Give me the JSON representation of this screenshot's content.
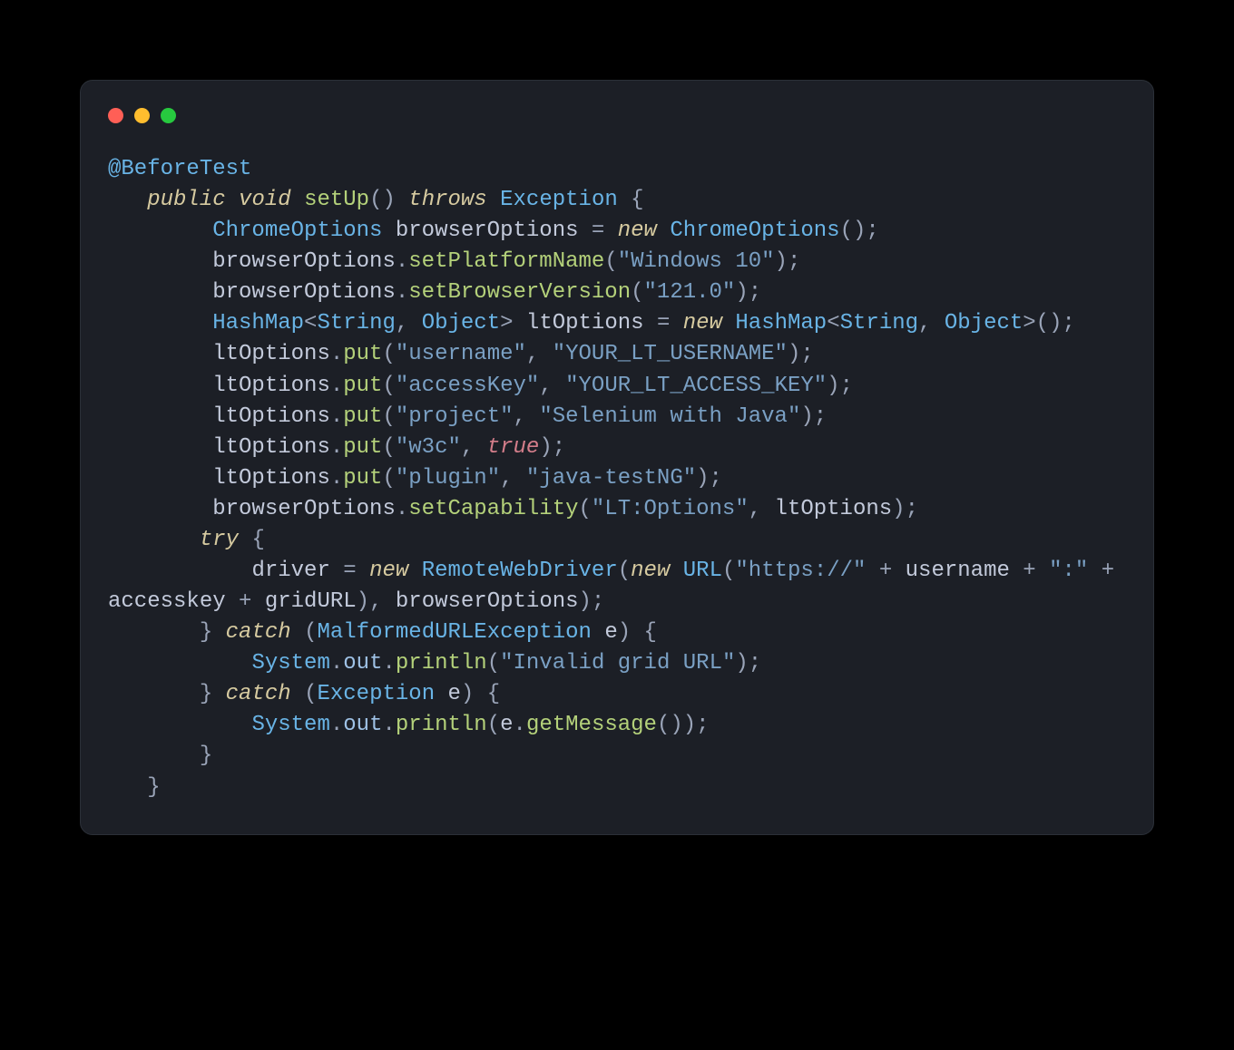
{
  "theme": {
    "background": "#000000",
    "panel_bg": "#1c1f26",
    "panel_border": "#2b3038",
    "traffic_red": "#ff5f56",
    "traffic_yellow": "#ffbd2e",
    "traffic_green": "#27c93f",
    "default_text": "#c3cadb",
    "annotation": "#69b4e6",
    "keyword": "#d6caa0",
    "type": "#69b4e6",
    "method": "#b4d17a",
    "string": "#7aa0c4",
    "literal": "#d37d8a",
    "punctuation": "#9aa4b8",
    "field": "#9fc2e6"
  },
  "code": {
    "language": "java",
    "plain_text": "@BeforeTest\n   public void setUp() throws Exception {\n        ChromeOptions browserOptions = new ChromeOptions();\n        browserOptions.setPlatformName(\"Windows 10\");\n        browserOptions.setBrowserVersion(\"121.0\");\n        HashMap<String, Object> ltOptions = new HashMap<String, Object>();\n        ltOptions.put(\"username\", \"YOUR_LT_USERNAME\");\n        ltOptions.put(\"accessKey\", \"YOUR_LT_ACCESS_KEY\");\n        ltOptions.put(\"project\", \"Selenium with Java\");\n        ltOptions.put(\"w3c\", true);\n        ltOptions.put(\"plugin\", \"java-testNG\");\n        browserOptions.setCapability(\"LT:Options\", ltOptions);\n       try {\n           driver = new RemoteWebDriver(new URL(\"https://\" + username + \":\" + accesskey + gridURL), browserOptions);\n       } catch (MalformedURLException e) {\n           System.out.println(\"Invalid grid URL\");\n       } catch (Exception e) {\n           System.out.println(e.getMessage());\n       }\n   }",
    "lines": [
      [
        {
          "t": "annot",
          "v": "@BeforeTest"
        }
      ],
      [
        {
          "t": "sp",
          "v": "   "
        },
        {
          "t": "kw",
          "v": "public"
        },
        {
          "t": "sp",
          "v": " "
        },
        {
          "t": "kw",
          "v": "void"
        },
        {
          "t": "sp",
          "v": " "
        },
        {
          "t": "method",
          "v": "setUp"
        },
        {
          "t": "punct",
          "v": "()"
        },
        {
          "t": "sp",
          "v": " "
        },
        {
          "t": "kw",
          "v": "throws"
        },
        {
          "t": "sp",
          "v": " "
        },
        {
          "t": "type",
          "v": "Exception"
        },
        {
          "t": "sp",
          "v": " "
        },
        {
          "t": "punct",
          "v": "{"
        }
      ],
      [
        {
          "t": "sp",
          "v": "        "
        },
        {
          "t": "type",
          "v": "ChromeOptions"
        },
        {
          "t": "sp",
          "v": " "
        },
        {
          "t": "ident",
          "v": "browserOptions"
        },
        {
          "t": "sp",
          "v": " "
        },
        {
          "t": "punct",
          "v": "="
        },
        {
          "t": "sp",
          "v": " "
        },
        {
          "t": "kw",
          "v": "new"
        },
        {
          "t": "sp",
          "v": " "
        },
        {
          "t": "type",
          "v": "ChromeOptions"
        },
        {
          "t": "punct",
          "v": "();"
        }
      ],
      [
        {
          "t": "sp",
          "v": "        "
        },
        {
          "t": "ident",
          "v": "browserOptions"
        },
        {
          "t": "punct",
          "v": "."
        },
        {
          "t": "method",
          "v": "setPlatformName"
        },
        {
          "t": "punct",
          "v": "("
        },
        {
          "t": "str",
          "v": "\"Windows 10\""
        },
        {
          "t": "punct",
          "v": ");"
        }
      ],
      [
        {
          "t": "sp",
          "v": "        "
        },
        {
          "t": "ident",
          "v": "browserOptions"
        },
        {
          "t": "punct",
          "v": "."
        },
        {
          "t": "method",
          "v": "setBrowserVersion"
        },
        {
          "t": "punct",
          "v": "("
        },
        {
          "t": "str",
          "v": "\"121.0\""
        },
        {
          "t": "punct",
          "v": ");"
        }
      ],
      [
        {
          "t": "sp",
          "v": "        "
        },
        {
          "t": "type",
          "v": "HashMap"
        },
        {
          "t": "punct",
          "v": "<"
        },
        {
          "t": "type",
          "v": "String"
        },
        {
          "t": "punct",
          "v": ", "
        },
        {
          "t": "type",
          "v": "Object"
        },
        {
          "t": "punct",
          "v": ">"
        },
        {
          "t": "sp",
          "v": " "
        },
        {
          "t": "ident",
          "v": "ltOptions"
        },
        {
          "t": "sp",
          "v": " "
        },
        {
          "t": "punct",
          "v": "="
        },
        {
          "t": "sp",
          "v": " "
        },
        {
          "t": "kw",
          "v": "new"
        },
        {
          "t": "sp",
          "v": " "
        },
        {
          "t": "type",
          "v": "HashMap"
        },
        {
          "t": "punct",
          "v": "<"
        },
        {
          "t": "type",
          "v": "String"
        },
        {
          "t": "punct",
          "v": ", "
        },
        {
          "t": "type",
          "v": "Object"
        },
        {
          "t": "punct",
          "v": ">();"
        }
      ],
      [
        {
          "t": "sp",
          "v": "        "
        },
        {
          "t": "ident",
          "v": "ltOptions"
        },
        {
          "t": "punct",
          "v": "."
        },
        {
          "t": "method",
          "v": "put"
        },
        {
          "t": "punct",
          "v": "("
        },
        {
          "t": "str",
          "v": "\"username\""
        },
        {
          "t": "punct",
          "v": ", "
        },
        {
          "t": "str",
          "v": "\"YOUR_LT_USERNAME\""
        },
        {
          "t": "punct",
          "v": ");"
        }
      ],
      [
        {
          "t": "sp",
          "v": "        "
        },
        {
          "t": "ident",
          "v": "ltOptions"
        },
        {
          "t": "punct",
          "v": "."
        },
        {
          "t": "method",
          "v": "put"
        },
        {
          "t": "punct",
          "v": "("
        },
        {
          "t": "str",
          "v": "\"accessKey\""
        },
        {
          "t": "punct",
          "v": ", "
        },
        {
          "t": "str",
          "v": "\"YOUR_LT_ACCESS_KEY\""
        },
        {
          "t": "punct",
          "v": ");"
        }
      ],
      [
        {
          "t": "sp",
          "v": "        "
        },
        {
          "t": "ident",
          "v": "ltOptions"
        },
        {
          "t": "punct",
          "v": "."
        },
        {
          "t": "method",
          "v": "put"
        },
        {
          "t": "punct",
          "v": "("
        },
        {
          "t": "str",
          "v": "\"project\""
        },
        {
          "t": "punct",
          "v": ", "
        },
        {
          "t": "str",
          "v": "\"Selenium with Java\""
        },
        {
          "t": "punct",
          "v": ");"
        }
      ],
      [
        {
          "t": "sp",
          "v": "        "
        },
        {
          "t": "ident",
          "v": "ltOptions"
        },
        {
          "t": "punct",
          "v": "."
        },
        {
          "t": "method",
          "v": "put"
        },
        {
          "t": "punct",
          "v": "("
        },
        {
          "t": "str",
          "v": "\"w3c\""
        },
        {
          "t": "punct",
          "v": ", "
        },
        {
          "t": "lit",
          "v": "true"
        },
        {
          "t": "punct",
          "v": ");"
        }
      ],
      [
        {
          "t": "sp",
          "v": "        "
        },
        {
          "t": "ident",
          "v": "ltOptions"
        },
        {
          "t": "punct",
          "v": "."
        },
        {
          "t": "method",
          "v": "put"
        },
        {
          "t": "punct",
          "v": "("
        },
        {
          "t": "str",
          "v": "\"plugin\""
        },
        {
          "t": "punct",
          "v": ", "
        },
        {
          "t": "str",
          "v": "\"java-testNG\""
        },
        {
          "t": "punct",
          "v": ");"
        }
      ],
      [
        {
          "t": "sp",
          "v": "        "
        },
        {
          "t": "ident",
          "v": "browserOptions"
        },
        {
          "t": "punct",
          "v": "."
        },
        {
          "t": "method",
          "v": "setCapability"
        },
        {
          "t": "punct",
          "v": "("
        },
        {
          "t": "str",
          "v": "\"LT:Options\""
        },
        {
          "t": "punct",
          "v": ", "
        },
        {
          "t": "ident",
          "v": "ltOptions"
        },
        {
          "t": "punct",
          "v": ");"
        }
      ],
      [
        {
          "t": "sp",
          "v": "       "
        },
        {
          "t": "kw",
          "v": "try"
        },
        {
          "t": "sp",
          "v": " "
        },
        {
          "t": "punct",
          "v": "{"
        }
      ],
      [
        {
          "t": "sp",
          "v": "           "
        },
        {
          "t": "ident",
          "v": "driver"
        },
        {
          "t": "sp",
          "v": " "
        },
        {
          "t": "punct",
          "v": "="
        },
        {
          "t": "sp",
          "v": " "
        },
        {
          "t": "kw",
          "v": "new"
        },
        {
          "t": "sp",
          "v": " "
        },
        {
          "t": "type",
          "v": "RemoteWebDriver"
        },
        {
          "t": "punct",
          "v": "("
        },
        {
          "t": "kw",
          "v": "new"
        },
        {
          "t": "sp",
          "v": " "
        },
        {
          "t": "type",
          "v": "URL"
        },
        {
          "t": "punct",
          "v": "("
        },
        {
          "t": "str",
          "v": "\"https://\""
        },
        {
          "t": "sp",
          "v": " "
        },
        {
          "t": "punct",
          "v": "+"
        },
        {
          "t": "sp",
          "v": " "
        },
        {
          "t": "ident",
          "v": "username"
        },
        {
          "t": "sp",
          "v": " "
        },
        {
          "t": "punct",
          "v": "+"
        },
        {
          "t": "sp",
          "v": " "
        },
        {
          "t": "str",
          "v": "\":\""
        },
        {
          "t": "sp",
          "v": " "
        },
        {
          "t": "punct",
          "v": "+"
        },
        {
          "t": "sp",
          "v": " "
        },
        {
          "t": "ident",
          "v": "accesskey"
        },
        {
          "t": "sp",
          "v": " "
        },
        {
          "t": "punct",
          "v": "+"
        },
        {
          "t": "sp",
          "v": " "
        },
        {
          "t": "ident",
          "v": "gridURL"
        },
        {
          "t": "punct",
          "v": "), "
        },
        {
          "t": "ident",
          "v": "browserOptions"
        },
        {
          "t": "punct",
          "v": ");"
        }
      ],
      [
        {
          "t": "sp",
          "v": "       "
        },
        {
          "t": "punct",
          "v": "}"
        },
        {
          "t": "sp",
          "v": " "
        },
        {
          "t": "kw",
          "v": "catch"
        },
        {
          "t": "sp",
          "v": " "
        },
        {
          "t": "punct",
          "v": "("
        },
        {
          "t": "type",
          "v": "MalformedURLException"
        },
        {
          "t": "sp",
          "v": " "
        },
        {
          "t": "ident",
          "v": "e"
        },
        {
          "t": "punct",
          "v": ")"
        },
        {
          "t": "sp",
          "v": " "
        },
        {
          "t": "punct",
          "v": "{"
        }
      ],
      [
        {
          "t": "sp",
          "v": "           "
        },
        {
          "t": "type",
          "v": "System"
        },
        {
          "t": "punct",
          "v": "."
        },
        {
          "t": "field",
          "v": "out"
        },
        {
          "t": "punct",
          "v": "."
        },
        {
          "t": "method",
          "v": "println"
        },
        {
          "t": "punct",
          "v": "("
        },
        {
          "t": "str",
          "v": "\"Invalid grid URL\""
        },
        {
          "t": "punct",
          "v": ");"
        }
      ],
      [
        {
          "t": "sp",
          "v": "       "
        },
        {
          "t": "punct",
          "v": "}"
        },
        {
          "t": "sp",
          "v": " "
        },
        {
          "t": "kw",
          "v": "catch"
        },
        {
          "t": "sp",
          "v": " "
        },
        {
          "t": "punct",
          "v": "("
        },
        {
          "t": "type",
          "v": "Exception"
        },
        {
          "t": "sp",
          "v": " "
        },
        {
          "t": "ident",
          "v": "e"
        },
        {
          "t": "punct",
          "v": ")"
        },
        {
          "t": "sp",
          "v": " "
        },
        {
          "t": "punct",
          "v": "{"
        }
      ],
      [
        {
          "t": "sp",
          "v": "           "
        },
        {
          "t": "type",
          "v": "System"
        },
        {
          "t": "punct",
          "v": "."
        },
        {
          "t": "field",
          "v": "out"
        },
        {
          "t": "punct",
          "v": "."
        },
        {
          "t": "method",
          "v": "println"
        },
        {
          "t": "punct",
          "v": "("
        },
        {
          "t": "ident",
          "v": "e"
        },
        {
          "t": "punct",
          "v": "."
        },
        {
          "t": "method",
          "v": "getMessage"
        },
        {
          "t": "punct",
          "v": "());"
        }
      ],
      [
        {
          "t": "sp",
          "v": "       "
        },
        {
          "t": "punct",
          "v": "}"
        }
      ],
      [
        {
          "t": "sp",
          "v": "   "
        },
        {
          "t": "punct",
          "v": "}"
        }
      ]
    ]
  }
}
